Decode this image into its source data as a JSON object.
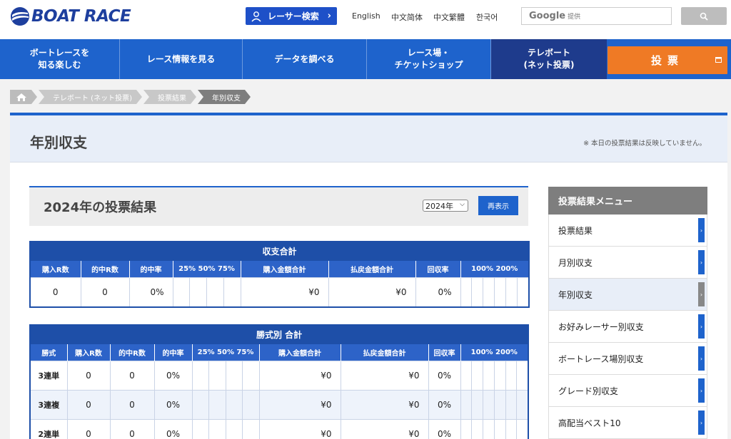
{
  "header": {
    "logo_text": "BOAT RACE",
    "racer_search": "レーサー検索",
    "languages": [
      "English",
      "中文简体",
      "中文繁體",
      "한국어"
    ],
    "google_label": "Google",
    "google_sub": "提供"
  },
  "nav": {
    "items": [
      "ボートレースを\n知る楽しむ",
      "レース情報を見る",
      "データを調べる",
      "レース場・\nチケットショップ",
      "テレボート\n(ネット投票)"
    ],
    "vote_label": "投票"
  },
  "breadcrumb": [
    "テレボート (ネット投票)",
    "投票結果",
    "年別収支"
  ],
  "page": {
    "title": "年別収支",
    "note": "※ 本日の投票結果は反映していません。",
    "result_title": "2024年の投票結果",
    "year_value": "2024年",
    "redisplay_label": "再表示"
  },
  "summary_table": {
    "caption": "収支合計",
    "headers": [
      "購入R数",
      "的中R数",
      "的中率",
      "25% 50% 75%",
      "購入金額合計",
      "払戻金額合計",
      "回収率",
      "100% 200%"
    ],
    "row": [
      "0",
      "0",
      "0%",
      "¥0",
      "¥0",
      "0%"
    ]
  },
  "bettype_table": {
    "caption": "勝式別 合計",
    "headers": [
      "勝式",
      "購入R数",
      "的中R数",
      "的中率",
      "25% 50% 75%",
      "購入金額合計",
      "払戻金額合計",
      "回収率",
      "100% 200%"
    ],
    "rows": [
      {
        "type": "3連単",
        "buy": "0",
        "hit": "0",
        "rate": "0%",
        "amount": "¥0",
        "payout": "¥0",
        "recovery": "0%"
      },
      {
        "type": "3連複",
        "buy": "0",
        "hit": "0",
        "rate": "0%",
        "amount": "¥0",
        "payout": "¥0",
        "recovery": "0%"
      },
      {
        "type": "2連単",
        "buy": "0",
        "hit": "0",
        "rate": "0%",
        "amount": "¥0",
        "payout": "¥0",
        "recovery": "0%"
      }
    ]
  },
  "side_menu": {
    "title": "投票結果メニュー",
    "items": [
      "投票結果",
      "月別収支",
      "年別収支",
      "お好みレーサー別収支",
      "ボートレース場別収支",
      "グレード別収支",
      "高配当ベスト10"
    ],
    "current_index": 2
  },
  "colors": {
    "brand_blue": "#1e63cc",
    "nav_active": "#1e3b8c",
    "vote_orange": "#ef7a25"
  }
}
